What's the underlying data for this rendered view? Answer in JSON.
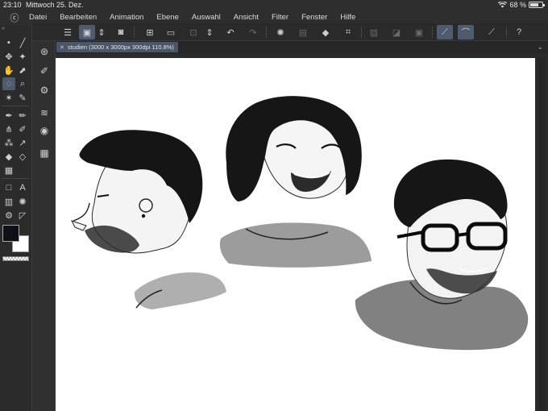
{
  "status_bar": {
    "time": "23:10",
    "date": "Mittwoch 25. Dez.",
    "battery": "68 %",
    "battery_level": 0.68
  },
  "menu": {
    "items": [
      "Datei",
      "Bearbeiten",
      "Animation",
      "Ebene",
      "Auswahl",
      "Ansicht",
      "Filter",
      "Fenster",
      "Hilfe"
    ]
  },
  "document": {
    "tab_title": "studien (3000 x 3000px 300dpi 110.8%)"
  },
  "colors": {
    "main_color": "#0e1016",
    "sub_color": "#ffffff",
    "accent": "#4d5a70"
  },
  "toolbar": {
    "icons": [
      "menu-icon",
      "selection-launcher-icon",
      "stepper-icon",
      "clip-studio-icon",
      "new-canvas-icon",
      "open-icon",
      "save-icon",
      "updown-icon",
      "undo-icon",
      "redo-icon",
      "loading-icon",
      "clear-icon",
      "fill-icon",
      "transform-icon",
      "hide-selection-icon",
      "crop-icon",
      "reference-layer-icon",
      "ruler-snap-icon",
      "special-ruler-snap-icon",
      "grid-snap-icon",
      "help-icon"
    ]
  }
}
